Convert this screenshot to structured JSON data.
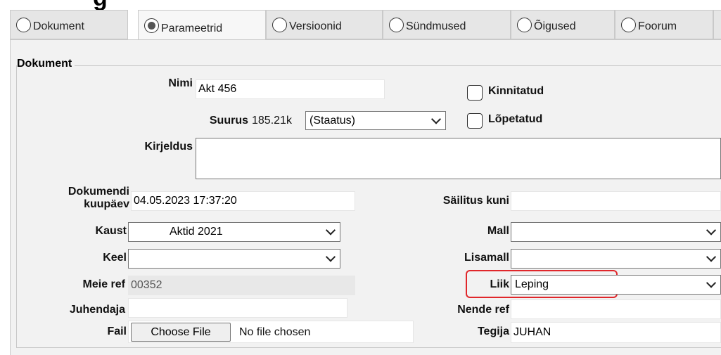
{
  "page": {
    "partial_title": "g"
  },
  "tabs": [
    {
      "label": "Dokument",
      "selected": false
    },
    {
      "label": "Parameetrid",
      "selected": true
    },
    {
      "label": "Versioonid",
      "selected": false
    },
    {
      "label": "Sündmused",
      "selected": false
    },
    {
      "label": "Õigused",
      "selected": false
    },
    {
      "label": "Foorum",
      "selected": false
    }
  ],
  "form": {
    "legend": "Dokument",
    "nimi": {
      "label": "Nimi",
      "value": "Akt 456"
    },
    "kinnitatud": {
      "label": "Kinnitatud",
      "checked": false
    },
    "suurus": {
      "label": "Suurus",
      "value": "185.21k"
    },
    "staatus": {
      "value": "(Staatus)"
    },
    "lopetatud": {
      "label": "Lõpetatud",
      "checked": false
    },
    "kirjeldus": {
      "label": "Kirjeldus",
      "value": ""
    },
    "dokumendi_kuupaev": {
      "label_line1": "Dokumendi",
      "label_line2": "kuupäev",
      "value": "04.05.2023 17:37:20"
    },
    "sailitus_kuni": {
      "label": "Säilitus kuni",
      "value": ""
    },
    "kaust": {
      "label": "Kaust",
      "value": "Aktid 2021"
    },
    "mall": {
      "label": "Mall",
      "value": ""
    },
    "keel": {
      "label": "Keel",
      "value": ""
    },
    "lisamall": {
      "label": "Lisamall",
      "value": ""
    },
    "meie_ref": {
      "label": "Meie ref",
      "value": "00352"
    },
    "liik": {
      "label": "Liik",
      "value": "Leping"
    },
    "juhendaja": {
      "label": "Juhendaja",
      "value": ""
    },
    "nende_ref": {
      "label": "Nende ref",
      "value": ""
    },
    "fail": {
      "label": "Fail",
      "button": "Choose File",
      "status": "No file chosen"
    },
    "tegija": {
      "label": "Tegija",
      "value": "JUHAN"
    }
  },
  "colors": {
    "highlight": "#e0272b",
    "panel": "#f2f2f2",
    "tab": "#e6e6e6"
  }
}
